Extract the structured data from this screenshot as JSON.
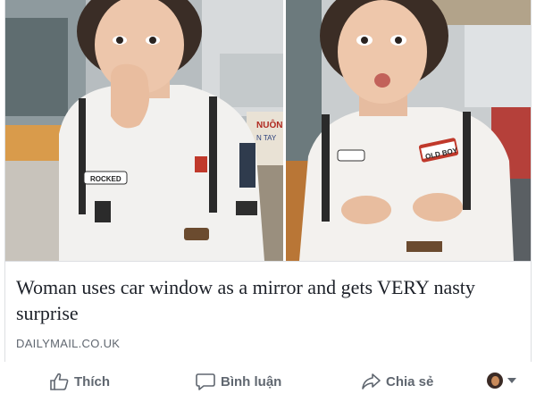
{
  "post": {
    "headline": "Woman uses car window as a mirror and gets VERY nasty surprise",
    "domain": "DAILYMAIL.CO.UK",
    "images": [
      {
        "description_icon": "photo-woman-nose",
        "patch_text": "ROCKED"
      },
      {
        "description_icon": "photo-woman-pouting",
        "patch_text": "OLD BOY"
      }
    ],
    "sign_text": "NUÔN",
    "sign_text2": "N TAY"
  },
  "actions": {
    "like_label": "Thích",
    "comment_label": "Bình luận",
    "share_label": "Chia sẻ"
  },
  "colors": {
    "text_primary": "#1d2129",
    "text_secondary": "#606770",
    "border": "#dddfe2"
  }
}
